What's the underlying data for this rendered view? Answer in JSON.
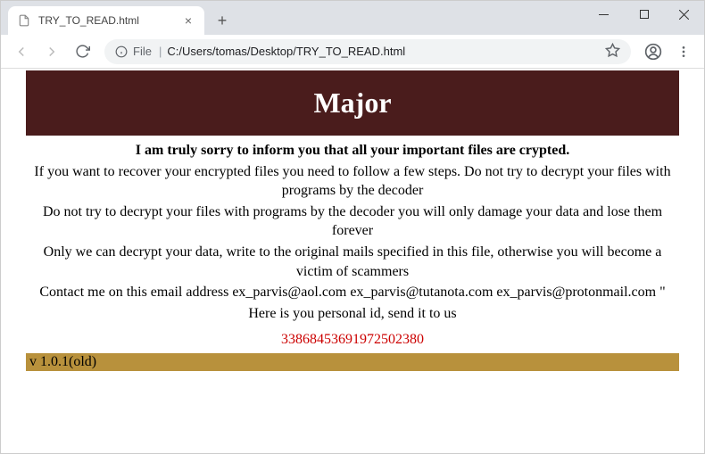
{
  "tab": {
    "title": "TRY_TO_READ.html"
  },
  "addressBar": {
    "fileLabel": "File",
    "url": "C:/Users/tomas/Desktop/TRY_TO_READ.html"
  },
  "page": {
    "headerTitle": "Major",
    "boldLine": "I am truly sorry to inform you that all your important files are crypted.",
    "para1": "If you want to recover your encrypted files you need to follow a few steps. Do not try to decrypt your files with programs by the decoder",
    "para2": "Do not try to decrypt your files with programs by the decoder you will only damage your data and lose them forever",
    "para3": "Only we can decrypt your data, write to the original mails specified in this file, otherwise you will become a victim of scammers",
    "para4": "Contact me on this email address ex_parvis@aol.com ex_parvis@tutanota.com ex_parvis@protonmail.com \"",
    "para5": "Here is you personal id, send it to us",
    "personalId": "33868453691972502380",
    "version": " v 1.0.1(old)"
  }
}
